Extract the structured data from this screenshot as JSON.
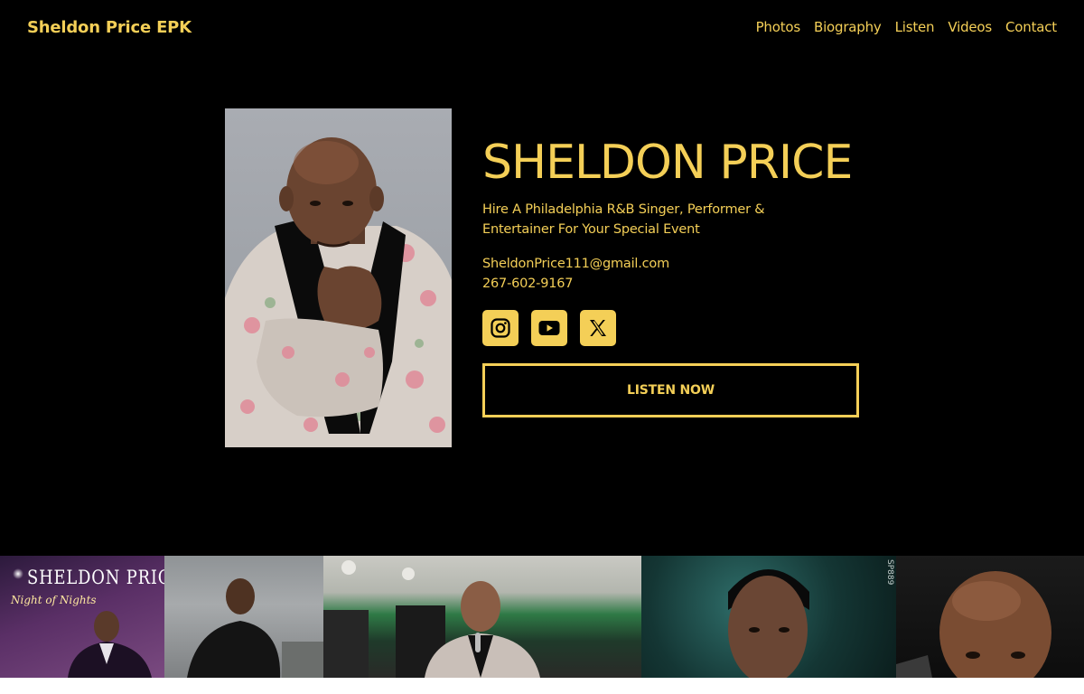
{
  "header": {
    "brand": "Sheldon Price EPK",
    "nav": [
      "Photos",
      "Biography",
      "Listen",
      "Videos",
      "Contact"
    ]
  },
  "hero": {
    "name": "SHELDON PRICE",
    "tagline": "Hire A Philadelphia R&B Singer, Performer & Entertainer For Your Special Event",
    "email": "SheldonPrice111@gmail.com",
    "phone": "267-602-9167",
    "socials": [
      "instagram-icon",
      "youtube-icon",
      "x-icon"
    ],
    "cta": "LISTEN NOW"
  },
  "strip": {
    "album_title": "SHELDON PRICE",
    "album_subtitle": "Night of Nights",
    "photo_code": "SP889"
  },
  "colors": {
    "accent": "#f4cf57",
    "background": "#000000"
  }
}
